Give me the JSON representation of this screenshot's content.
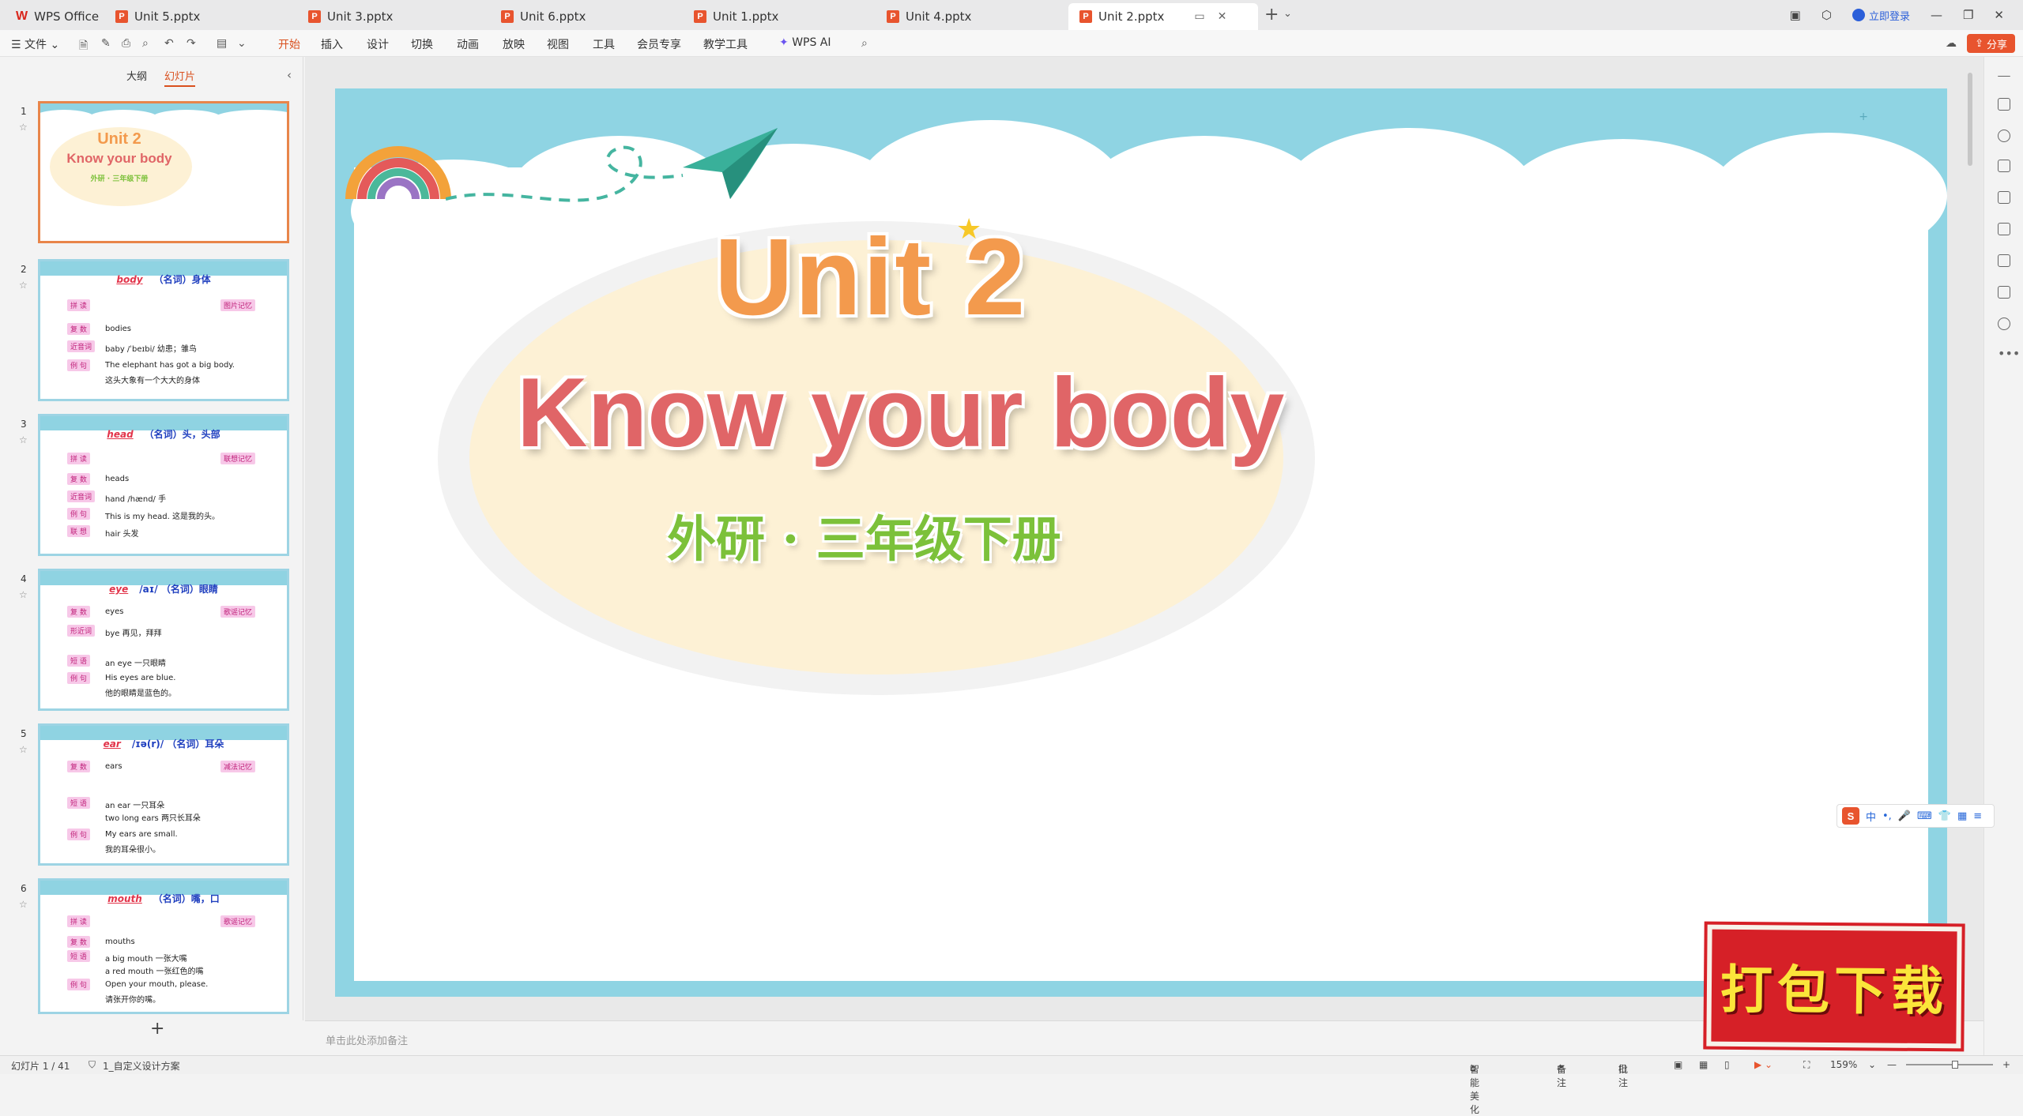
{
  "tabs": [
    {
      "label": "WPS Office",
      "type": "home"
    },
    {
      "label": "Unit 5.pptx"
    },
    {
      "label": "Unit 3.pptx"
    },
    {
      "label": "Unit 6.pptx"
    },
    {
      "label": "Unit 1.pptx"
    },
    {
      "label": "Unit 4.pptx"
    },
    {
      "label": "Unit 2.pptx",
      "active": true
    }
  ],
  "titlebar": {
    "login": "立即登录"
  },
  "menu": {
    "file": "文件",
    "items": [
      "开始",
      "插入",
      "设计",
      "切换",
      "动画",
      "放映",
      "视图",
      "工具",
      "会员专享",
      "教学工具",
      "WPS AI"
    ],
    "share": "分享"
  },
  "leftpanel": {
    "tab_outline": "大纲",
    "tab_slides": "幻灯片",
    "thumbs": [
      {
        "num": "1",
        "unit": "Unit 2",
        "title": "Know your body",
        "sub": "外研 · 三年级下册"
      },
      {
        "num": "2",
        "word": "body",
        "pos": "（名词）身体",
        "lines": [
          "bodies",
          "baby /ˈbeɪbi/ 幼患；雏鸟",
          "The elephant has got a big body.",
          "这头大象有一个大大的身体"
        ]
      },
      {
        "num": "3",
        "word": "head",
        "pos": "（名词）头，头部",
        "lines": [
          "heads",
          "hand /hænd/ 手",
          "This is my head. 这是我的头。",
          "hair 头发"
        ]
      },
      {
        "num": "4",
        "word": "eye",
        "pos": "/aɪ/ （名词）眼睛",
        "lines": [
          "eyes",
          "bye 再见，拜拜",
          "an eye 一只眼睛",
          "His eyes are blue.",
          "他的眼睛是蓝色的。"
        ]
      },
      {
        "num": "5",
        "word": "ear",
        "pos": "/ɪə(r)/ （名词）耳朵",
        "lines": [
          "ears",
          "an ear 一只耳朵",
          "two long ears 两只长耳朵",
          "My ears are small.",
          "我的耳朵很小。"
        ]
      },
      {
        "num": "6",
        "word": "mouth",
        "pos": "（名词）嘴，口",
        "lines": [
          "mouths",
          "a big mouth 一张大嘴",
          "a red mouth 一张红色的嘴",
          "Open your mouth, please.",
          "请张开你的嘴。"
        ]
      }
    ],
    "add_slide": "+"
  },
  "slide": {
    "unit": "Unit 2",
    "title": "Know your body",
    "subtitle": "外研 · 三年级下册",
    "colors": {
      "sky": "#8fd4e3",
      "unit": "#f39a4d",
      "title": "#e06567",
      "subtitle": "#7cc13a",
      "oval": "#fdf1d5"
    }
  },
  "notes_placeholder": "单击此处添加备注",
  "ime": {
    "mode": "中"
  },
  "download_stamp": "打包下载",
  "status": {
    "slide_counter": "幻灯片 1 / 41",
    "theme": "1_自定义设计方案",
    "beautify": "智能美化",
    "notes": "备注",
    "comments": "批注",
    "zoom": "159%"
  }
}
